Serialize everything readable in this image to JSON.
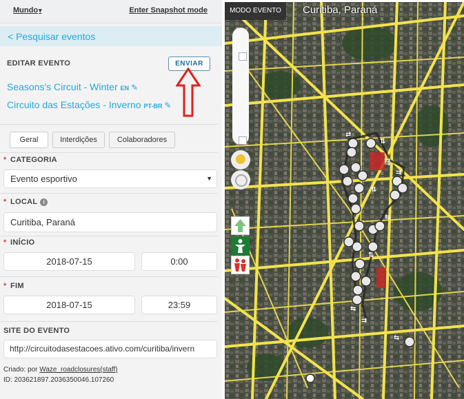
{
  "topbar": {
    "world_label": "Mundo",
    "snapshot_label": "Enter Snapshot mode"
  },
  "search_link": "< Pesquisar eventos",
  "edit": {
    "title": "EDITAR EVENTO",
    "send_label": "ENVIAR",
    "names": [
      {
        "text": "Seasons's Circuit - Winter",
        "lang": "EN"
      },
      {
        "text": "Circuito das Estações - Inverno",
        "lang": "PT-BR"
      }
    ]
  },
  "tabs": [
    "Geral",
    "Interdições",
    "Colaboradores"
  ],
  "form": {
    "category_label": "CATEGORIA",
    "category_value": "Evento esportivo",
    "local_label": "LOCAL",
    "local_value": "Curitiba, Paraná",
    "start_label": "INÍCIO",
    "start_date": "2018-07-15",
    "start_time": "0:00",
    "end_label": "FIM",
    "end_date": "2018-07-15",
    "end_time": "23:59",
    "site_label": "SITE DO EVENTO",
    "site_value": "http://circuitodasestacoes.ativo.com/curitiba/invern"
  },
  "meta": {
    "created_prefix": "Criado: por",
    "created_user": "Waze_roadclosures(staff)",
    "id_text": "ID: 203621897.2036350046.107260"
  },
  "map": {
    "mode_label": "MODO EVENTO",
    "city_label": "Curitiba, Paraná"
  },
  "colors": {
    "accent": "#27a8d8",
    "road_yellow": "#f2e34c",
    "annotation_red": "#e02020",
    "closure_green": "#1a7d35"
  },
  "icons": {
    "edit": "pencil-icon",
    "info": "info-icon",
    "dropdown": "chevron-down-icon",
    "closure": "closure-marker-icon"
  }
}
